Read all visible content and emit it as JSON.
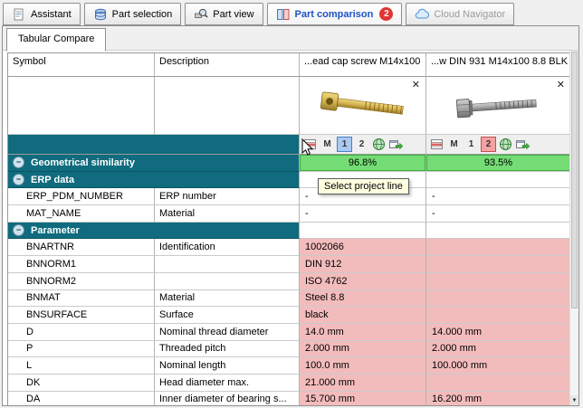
{
  "tabs": [
    {
      "label": "Assistant"
    },
    {
      "label": "Part selection"
    },
    {
      "label": "Part view"
    },
    {
      "label": "Part comparison",
      "badge": "2"
    },
    {
      "label": "Cloud Navigator"
    }
  ],
  "subtab": "Tabular Compare",
  "table": {
    "columns": {
      "symbol": "Symbol",
      "description": "Description"
    },
    "parts": [
      {
        "title": "...ead cap screw M14x100"
      },
      {
        "title": "...w DIN 931 M14x100 8.8 BLK"
      }
    ],
    "toolbar": {
      "m_label": "M",
      "line1_label": "1",
      "line2_label": "2"
    },
    "tooltip": "Select project line",
    "rows": [
      {
        "type": "section",
        "label": "Geometrical similarity",
        "v1": "96.8%",
        "v2": "93.5%",
        "cls": "green"
      },
      {
        "type": "section",
        "label": "ERP data",
        "cls": "plain"
      },
      {
        "type": "data",
        "name": "ERP_PDM_NUMBER",
        "desc": "ERP number",
        "v1": "-",
        "v2": "-",
        "cls": "plain"
      },
      {
        "type": "data",
        "name": "MAT_NAME",
        "desc": "Material",
        "v1": "-",
        "v2": "-",
        "cls": "plain"
      },
      {
        "type": "section",
        "label": "Parameter",
        "cls": "plain"
      },
      {
        "type": "data",
        "name": "BNARTNR",
        "desc": "Identification",
        "v1": "1002066",
        "v2": "",
        "cls": "pink"
      },
      {
        "type": "data",
        "name": "BNNORM1",
        "desc": "",
        "v1": "DIN 912",
        "v2": "",
        "cls": "pink"
      },
      {
        "type": "data",
        "name": "BNNORM2",
        "desc": "",
        "v1": "ISO 4762",
        "v2": "",
        "cls": "pink"
      },
      {
        "type": "data",
        "name": "BNMAT",
        "desc": "Material",
        "v1": "Steel 8.8",
        "v2": "",
        "cls": "pink"
      },
      {
        "type": "data",
        "name": "BNSURFACE",
        "desc": "Surface",
        "v1": "black",
        "v2": "",
        "cls": "pink"
      },
      {
        "type": "data",
        "name": "D",
        "desc": "Nominal thread diameter",
        "v1": "14.0 mm",
        "v2": "14.000 mm",
        "cls": "pink"
      },
      {
        "type": "data",
        "name": "P",
        "desc": "Threaded pitch",
        "v1": "2.000 mm",
        "v2": "2.000 mm",
        "cls": "pink"
      },
      {
        "type": "data",
        "name": "L",
        "desc": "Nominal length",
        "v1": "100.0 mm",
        "v2": "100.000 mm",
        "cls": "pink"
      },
      {
        "type": "data",
        "name": "DK",
        "desc": "Head diameter max.",
        "v1": "21.000 mm",
        "v2": "",
        "cls": "pink"
      },
      {
        "type": "data",
        "name": "DA",
        "desc": "Inner diameter of bearing s...",
        "v1": "15.700 mm",
        "v2": "16.200 mm",
        "cls": "pink"
      }
    ]
  },
  "icons": {
    "close": "✕",
    "collapse": "−",
    "scroll_down": "▼"
  },
  "colors": {
    "section_header": "#0f6b7d",
    "match_green": "#74dc74",
    "diff_pink": "#f3bcbc",
    "badge_red": "#e23434",
    "active_tab_text": "#1f53c5"
  }
}
